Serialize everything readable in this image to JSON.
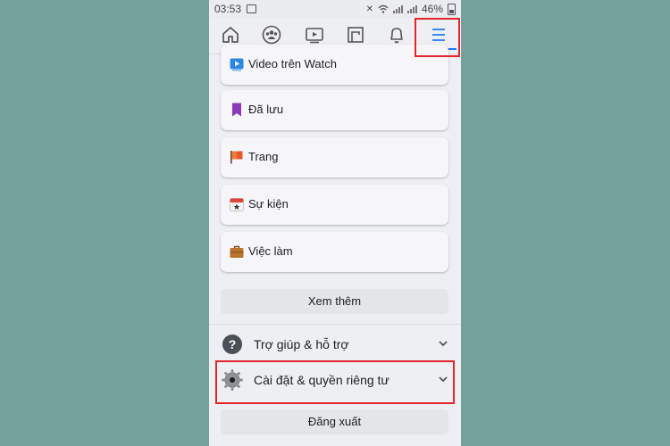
{
  "status_bar": {
    "time": "03:53",
    "battery": "46%"
  },
  "nav": {
    "items": [
      "home-icon",
      "groups-icon",
      "watch-icon",
      "marketplace-icon",
      "notifications-icon",
      "menu-icon"
    ],
    "active_color": "#1877f2"
  },
  "shortcuts": [
    {
      "label": "Video trên Watch",
      "icon": "watch-icon"
    },
    {
      "label": "Đã lưu",
      "icon": "saved-icon"
    },
    {
      "label": "Trang",
      "icon": "flag-icon"
    },
    {
      "label": "Sự kiện",
      "icon": "calendar-icon"
    },
    {
      "label": "Việc làm",
      "icon": "briefcase-icon"
    }
  ],
  "see_more": "Xem thêm",
  "help_support": "Trợ giúp & hỗ trợ",
  "settings_privacy": "Cài đặt & quyền riêng tư",
  "logout": "Đăng xuất",
  "colors": {
    "highlight": "#e3262d",
    "background": "#73a29d"
  }
}
